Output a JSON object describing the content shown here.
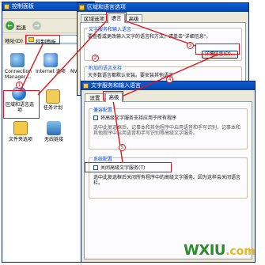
{
  "control_panel": {
    "title": "控制面板",
    "back_label": "后退",
    "address_label": "地址(D)",
    "address_value": "控制面板",
    "icons": [
      {
        "label": "Connection Manager ...",
        "icon": "connection-manager-icon"
      },
      {
        "label": "Internet 选项",
        "icon": "internet-options-icon"
      },
      {
        "label": "NV Dr",
        "icon": "nvidia-icon"
      },
      {
        "label": "区域和语言选项",
        "icon": "region-language-icon"
      },
      {
        "label": "任务计划",
        "icon": "scheduled-tasks-icon"
      },
      {
        "label": "文件夹选项",
        "icon": "folder-options-icon"
      },
      {
        "label": "无线链接",
        "icon": "wireless-link-icon"
      }
    ]
  },
  "region_dialog": {
    "title": "区域和语言选项",
    "tabs": [
      "区域选项",
      "语言",
      "高级"
    ],
    "text_services_group": "文字服务和输入语言",
    "text_services_desc": "要查看或更改输入文字的语言和方法，请单击\"详细信息\"。",
    "details_button": "详细信息(D)...",
    "supplemental_group": "附加的语言支持",
    "supplemental_desc": "大多数语言都默认安装。要安装其他语言"
  },
  "text_services_dialog": {
    "title": "文字服务和输入语言",
    "tabs": [
      "设置",
      "高级"
    ],
    "compat_group": "兼容配置",
    "compat_checkbox": "将高级文字服务支持应用于所有程序",
    "compat_desc": "选中此复选框后，记事本和其他程序中启用语音和手写识别，记事本和其他程序中启用语音和手写识别等高级文字服务。",
    "system_group": "系统配置",
    "system_checkbox": "关闭高级文字服务(T)",
    "system_desc": "选中此复选框后关闭所有程序中的高级文字服务。因为这样会关闭语言栏。"
  },
  "steps": [
    "1",
    "2",
    "3",
    "4",
    "5"
  ],
  "watermark": {
    "brand": "WXIU",
    "domain": ".com"
  },
  "colors": {
    "highlight_red": "#e0121c",
    "title_blue": "#0842a8",
    "dialog_bg": "#ece9d8",
    "watermark_green": "#2b8c2b",
    "watermark_yellow": "#f2b311"
  }
}
